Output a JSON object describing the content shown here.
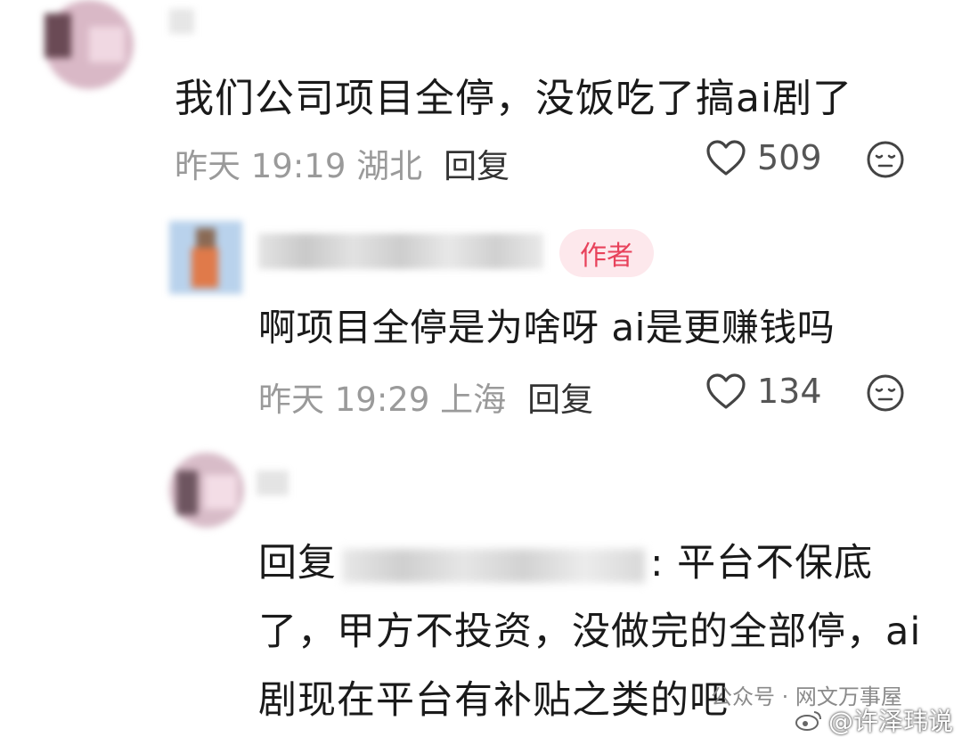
{
  "comments": [
    {
      "text": "我们公司项目全停，没饭吃了搞ai剧了",
      "meta_time": "昨天 19:19 湖北",
      "reply_label": "回复",
      "likes": "509"
    },
    {
      "author_badge": "作者",
      "text": "啊项目全停是为啥呀 ai是更赚钱吗",
      "meta_time": "昨天 19:29 上海",
      "reply_label": "回复",
      "likes": "134"
    },
    {
      "reply_prefix": "回复",
      "text_after_name": ": 平台不保底了，甲方不投资，没做完的全部停，ai剧现在平台有补贴之类的吧"
    }
  ],
  "watermarks": {
    "wechat": "公众号 · 网文万事屋",
    "weibo": "@许泽玮说"
  },
  "icons": {
    "like": "heart-outline-icon",
    "dislike": "meh-face-icon"
  },
  "colors": {
    "badge_bg": "#fde8ec",
    "badge_text": "#e8425b",
    "meta_gray": "#9a9a9a"
  }
}
